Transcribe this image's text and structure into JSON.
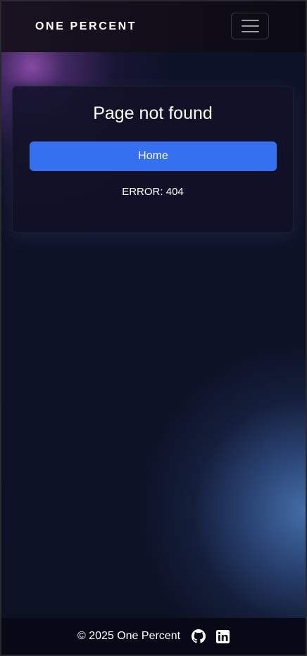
{
  "header": {
    "brand": "ONE PERCENT",
    "menu_icon": "hamburger-menu-icon"
  },
  "card": {
    "title": "Page not found",
    "home_button_label": "Home",
    "error_text": "ERROR: 404"
  },
  "footer": {
    "copyright": "© 2025 One Percent",
    "links": [
      {
        "icon": "github-icon"
      },
      {
        "icon": "linkedin-icon"
      }
    ]
  },
  "colors": {
    "accent": "#3470f0",
    "background": "#0c1124",
    "navbar": "#0b0a12",
    "footer": "#070a16"
  }
}
